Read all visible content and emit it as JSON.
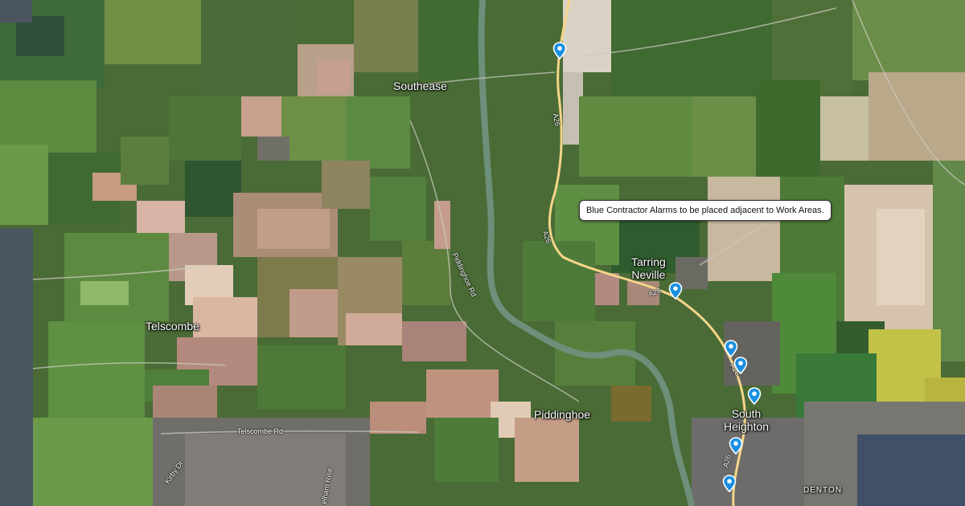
{
  "map": {
    "type": "satellite",
    "places": {
      "southease": "Southease",
      "telscombe": "Telscombe",
      "tarring_neville": "Tarring\nNeville",
      "piddinghoe": "Piddinghoe",
      "south_heighton": "South\nHeighton",
      "denton": "DENTON"
    },
    "roads": {
      "a26_1": "A26",
      "a26_2": "A26",
      "a26_3": "A26",
      "a26_4": "A26",
      "a26_5": "A26",
      "piddinghoe_rd": "Piddinghoe Rd",
      "telscombe_rd": "Telscombe Rd",
      "kirby_dr": "Kirby Dr",
      "pelham_rise": "elham Rise"
    },
    "callout": "Blue Contractor Alarms to be placed adjacent to Work Areas.",
    "marker_color": "#1a8fe0",
    "marker_count": 7
  }
}
